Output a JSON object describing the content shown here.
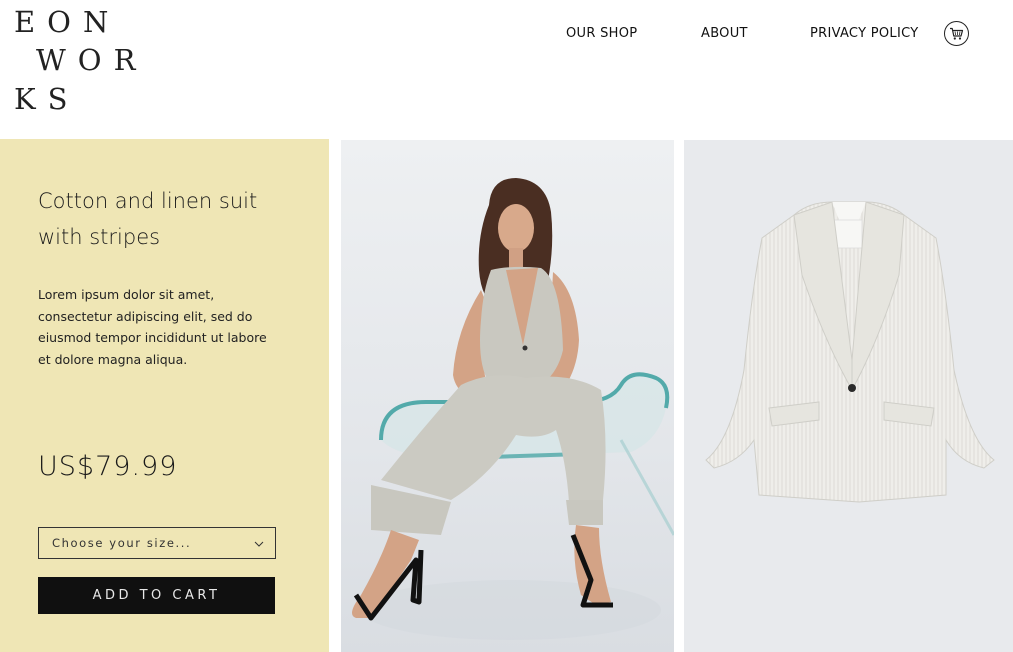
{
  "brand": {
    "line1": "EON",
    "line2": "WOR",
    "line3": "KS"
  },
  "nav": {
    "items": [
      "OUR SHOP",
      "ABOUT",
      "PRIVACY POLICY"
    ]
  },
  "product": {
    "title": "Cotton and linen suit with stripes",
    "description": "Lorem ipsum dolor sit amet, consectetur adipiscing elit, sed do eiusmod tempor incididunt ut labore et dolore magna aliqua.",
    "price": "US$79.99",
    "size_placeholder": "Choose your size...",
    "add_to_cart": "ADD TO CART"
  },
  "colors": {
    "panel": "#efe6b5",
    "button": "#101010"
  },
  "icons": {
    "cart": "cart-icon",
    "dropdown": "chevron-down-icon"
  }
}
